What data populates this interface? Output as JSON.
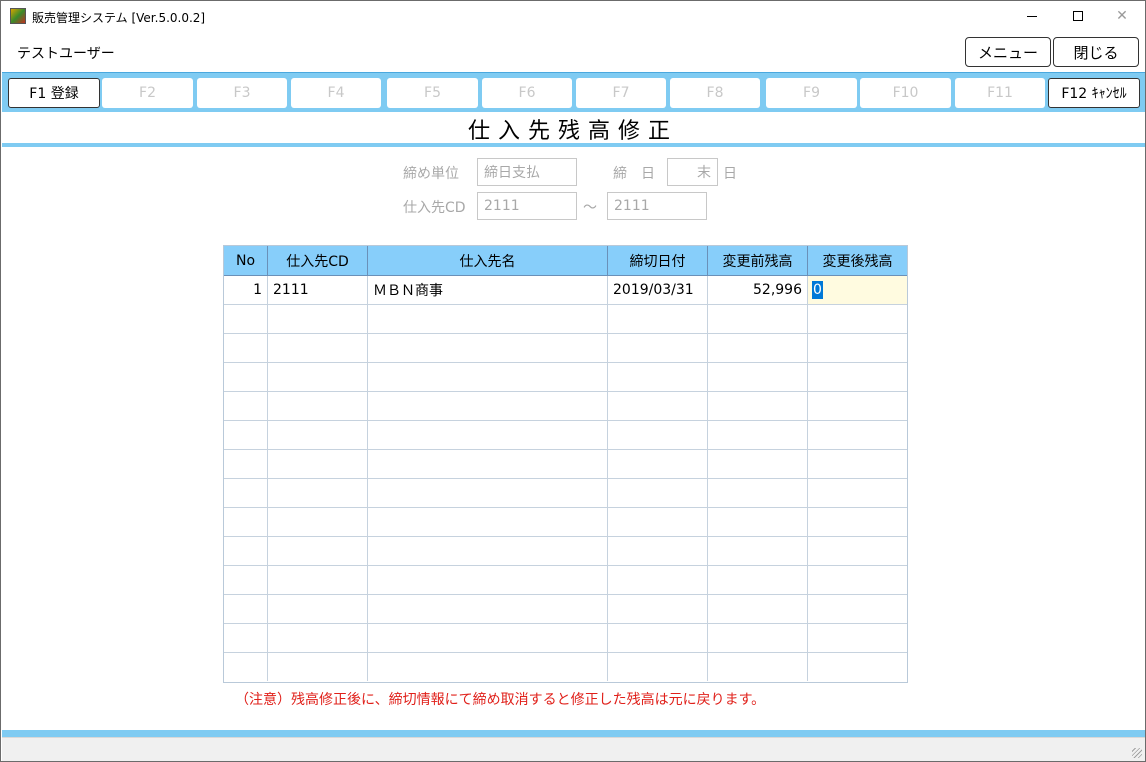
{
  "window": {
    "title": "販売管理システム [Ver.5.0.0.2]",
    "minimize_glyph": "",
    "close_glyph": "✕"
  },
  "header": {
    "user_name": "テストユーザー",
    "menu_label": "メニュー",
    "close_label": "閉じる"
  },
  "function_keys": [
    {
      "label": "F1 登録",
      "enabled": true
    },
    {
      "label": "F2",
      "enabled": false
    },
    {
      "label": "F3",
      "enabled": false
    },
    {
      "label": "F4",
      "enabled": false
    },
    {
      "label": "F5",
      "enabled": false
    },
    {
      "label": "F6",
      "enabled": false
    },
    {
      "label": "F7",
      "enabled": false
    },
    {
      "label": "F8",
      "enabled": false
    },
    {
      "label": "F9",
      "enabled": false
    },
    {
      "label": "F10",
      "enabled": false
    },
    {
      "label": "F11",
      "enabled": false
    },
    {
      "label": "F12 ｷｬﾝｾﾙ",
      "enabled": true
    }
  ],
  "screen_title": "仕入先残高修正",
  "filters": {
    "closing_unit_label": "締め単位",
    "closing_unit_value": "締日支払",
    "closing_day_label": "締　日",
    "closing_day_value": "末",
    "closing_day_suffix": "日",
    "supplier_cd_label": "仕入先CD",
    "supplier_cd_from": "2111",
    "range_separator": "～",
    "supplier_cd_to": "2111"
  },
  "grid": {
    "columns": [
      "No",
      "仕入先CD",
      "仕入先名",
      "締切日付",
      "変更前残高",
      "変更後残高"
    ],
    "rows": [
      {
        "no": "1",
        "supplier_cd": "2111",
        "supplier_name": "ＭＢＮ商事",
        "closing_date": "2019/03/31",
        "balance_before": "52,996",
        "balance_after": "0"
      }
    ],
    "total_rows": 14
  },
  "note": "（注意）残高修正後に、締切情報にて締め取消すると修正した残高は元に戻ります。",
  "colors": {
    "accent": "#7fcbf2",
    "grid_header": "#87cefa",
    "note_red": "#e0201a",
    "edit_cell": "#fffbe0",
    "selection": "#0078d7"
  }
}
